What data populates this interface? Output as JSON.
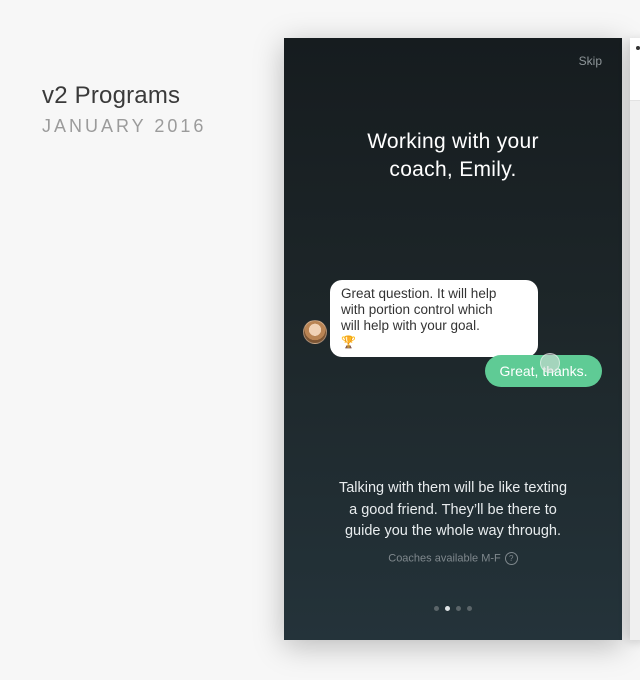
{
  "project": {
    "title": "v2 Programs",
    "date": "JANUARY 2016"
  },
  "onboarding": {
    "skip_label": "Skip",
    "headline_lines": [
      "Working with your",
      "coach, Emily."
    ],
    "coach_message_lines": [
      "Great question. It will help",
      "with portion control which",
      "will help with your goal."
    ],
    "coach_message_emoji": "🏆",
    "user_reply": "Great, thanks.",
    "body_lines": [
      "Talking with them will be like texting",
      "a good friend. They’ll be there to",
      "guide you the whole way through."
    ],
    "availability_note": "Coaches available M-F",
    "help_glyph": "?",
    "pager": {
      "count": 4,
      "active_index": 1
    }
  },
  "icons": {
    "help": "help-circle-icon",
    "trophy": "trophy-icon",
    "avatar": "coach-avatar"
  },
  "colors": {
    "background": "#f7f7f7",
    "accent_green": "#5fcb95",
    "phone_bg_top": "#161c1f",
    "phone_bg_bottom": "#24333a"
  }
}
